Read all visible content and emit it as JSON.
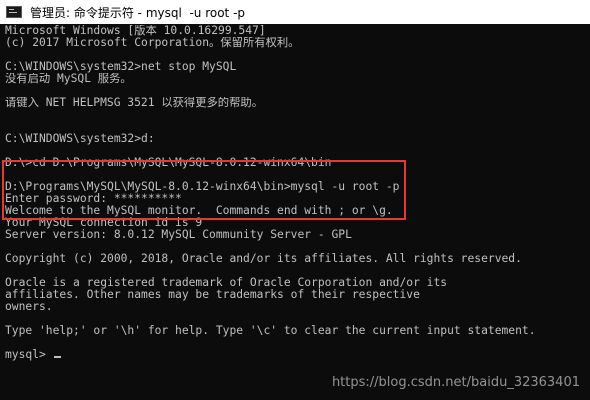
{
  "window": {
    "title": "管理员: 命令提示符 - mysql  -u root -p",
    "icon": "cmd-icon"
  },
  "console": {
    "lines": [
      "Microsoft Windows [版本 10.0.16299.547]",
      "(c) 2017 Microsoft Corporation。保留所有权利。",
      "",
      "C:\\WINDOWS\\system32>net stop MySQL",
      "没有启动 MySQL 服务。",
      "",
      "请键入 NET HELPMSG 3521 以获得更多的帮助。",
      "",
      "",
      "C:\\WINDOWS\\system32>d:",
      "",
      "D:\\>cd D:\\Programs\\MySQL\\MySQL-8.0.12-winx64\\bin",
      "",
      "D:\\Programs\\MySQL\\MySQL-8.0.12-winx64\\bin>mysql -u root -p",
      "Enter password: **********",
      "Welcome to the MySQL monitor.  Commands end with ; or \\g.",
      "Your MySQL connection id is 9",
      "Server version: 8.0.12 MySQL Community Server - GPL",
      "",
      "Copyright (c) 2000, 2018, Oracle and/or its affiliates. All rights reserved.",
      "",
      "Oracle is a registered trademark of Oracle Corporation and/or its",
      "affiliates. Other names may be trademarks of their respective",
      "owners.",
      "",
      "Type 'help;' or '\\h' for help. Type '\\c' to clear the current input statement.",
      ""
    ],
    "prompt": "mysql> "
  },
  "watermark": "https://blog.csdn.net/baidu_32363401",
  "colors": {
    "background": "#0c0c0c",
    "text": "#c0c0c0",
    "highlight_border": "#e53935",
    "titlebar": "#ffffff"
  }
}
